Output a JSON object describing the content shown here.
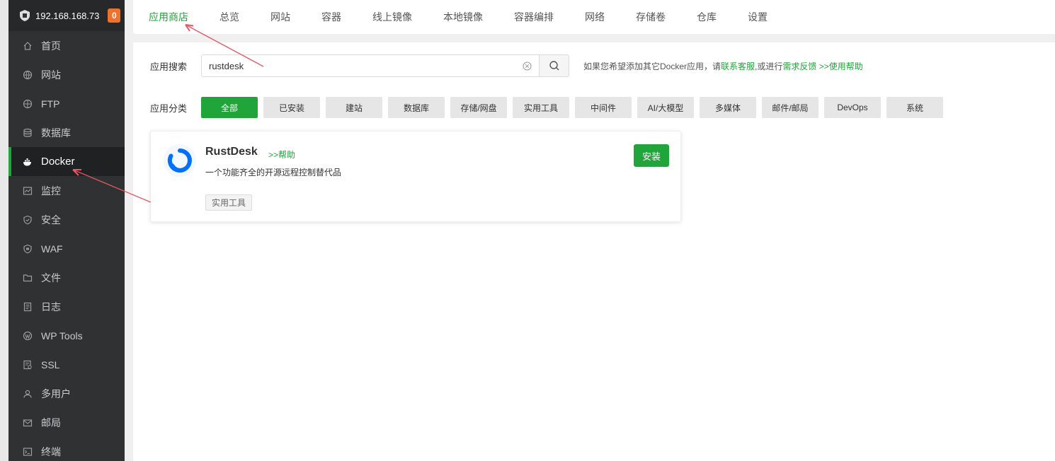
{
  "sidebar": {
    "ip": "192.168.168.73",
    "badge": "0",
    "items": [
      {
        "label": "首页",
        "icon": "home-icon"
      },
      {
        "label": "网站",
        "icon": "globe-icon"
      },
      {
        "label": "FTP",
        "icon": "ftp-icon"
      },
      {
        "label": "数据库",
        "icon": "database-icon"
      },
      {
        "label": "Docker",
        "icon": "docker-icon",
        "active": true
      },
      {
        "label": "监控",
        "icon": "monitor-icon"
      },
      {
        "label": "安全",
        "icon": "shield-icon"
      },
      {
        "label": "WAF",
        "icon": "waf-icon"
      },
      {
        "label": "文件",
        "icon": "folder-icon"
      },
      {
        "label": "日志",
        "icon": "log-icon"
      },
      {
        "label": "WP Tools",
        "icon": "wordpress-icon"
      },
      {
        "label": "SSL",
        "icon": "ssl-icon"
      },
      {
        "label": "多用户",
        "icon": "users-icon"
      },
      {
        "label": "邮局",
        "icon": "mail-icon"
      },
      {
        "label": "终端",
        "icon": "terminal-icon"
      }
    ]
  },
  "tabs": [
    "应用商店",
    "总览",
    "网站",
    "容器",
    "线上镜像",
    "本地镜像",
    "容器编排",
    "网络",
    "存储卷",
    "仓库",
    "设置"
  ],
  "search": {
    "label": "应用搜索",
    "value": "rustdesk",
    "help_prefix": "如果您希望添加其它Docker应用，请",
    "help_link1": "联系客服",
    "help_mid": ",或进行",
    "help_link2": "需求反馈",
    "help_link3": " >>使用帮助"
  },
  "categories": {
    "label": "应用分类",
    "items": [
      "全部",
      "已安装",
      "建站",
      "数据库",
      "存储/网盘",
      "实用工具",
      "中间件",
      "AI/大模型",
      "多媒体",
      "邮件/邮局",
      "DevOps",
      "系统"
    ]
  },
  "app": {
    "name": "RustDesk",
    "help": ">>帮助",
    "desc": "一个功能齐全的开源远程控制替代品",
    "tag": "实用工具",
    "install": "安装"
  },
  "colors": {
    "accent": "#20a53a",
    "badge": "#f0712c",
    "sidebar": "#2f3133",
    "arrow": "#e05a66"
  }
}
